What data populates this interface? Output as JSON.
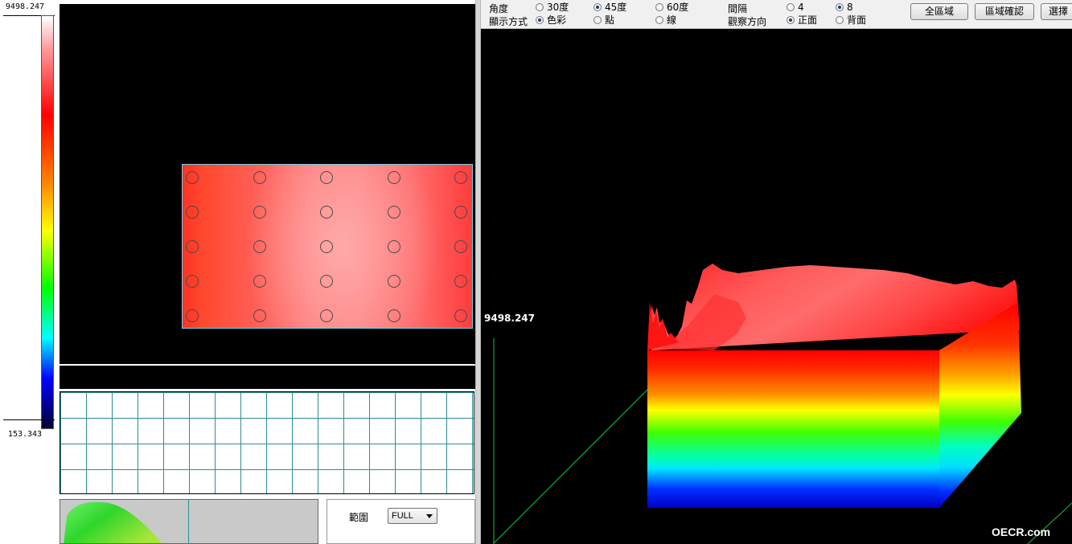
{
  "scale": {
    "max": "9498.247",
    "min": "153.343"
  },
  "image_view": {
    "point_rows": 5,
    "point_cols": 5
  },
  "range": {
    "label": "範圍",
    "value": "FULL"
  },
  "toolbar": {
    "angle": {
      "label": "角度",
      "options": [
        "30度",
        "45度",
        "60度"
      ],
      "selected": "45度"
    },
    "display": {
      "label": "顯示方式",
      "options": [
        "色彩",
        "點",
        "線"
      ],
      "selected": "色彩"
    },
    "interval": {
      "label": "間隔",
      "options": [
        "4",
        "8"
      ],
      "selected": "8"
    },
    "view_direction": {
      "label": "觀察方向",
      "options": [
        "正面",
        "背面"
      ],
      "selected": "正面"
    },
    "buttons": {
      "full_area": "全區域",
      "confirm_area": "區域確認",
      "select": "選擇"
    }
  },
  "view3d": {
    "max_value": "9498.247"
  },
  "watermark": "OECR.com",
  "colors": {
    "background_3d": "#000000",
    "surface_top": "#ff2a2a",
    "grid_line": "#2c8d95",
    "axis_line": "#1bbf3c"
  }
}
